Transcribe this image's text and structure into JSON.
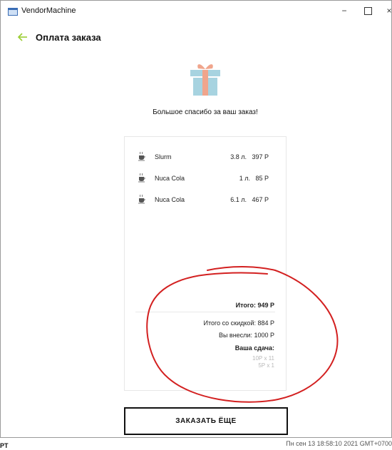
{
  "window": {
    "title": "VendorMachine",
    "minimize": "−",
    "close": "×"
  },
  "header": {
    "title": "Оплата заказа"
  },
  "thanks_text": "Большое спасибо за ваш заказ!",
  "items": [
    {
      "name": "Slurm",
      "volume_price": "3.8 л.   397 Р"
    },
    {
      "name": "Nuca Cola",
      "volume_price": "1 л.   85 Р"
    },
    {
      "name": "Nuca Cola",
      "volume_price": "6.1 л.   467 Р"
    }
  ],
  "summary": {
    "total": "Итого: 949 Р",
    "discount_total": "Итого со скидкой: 884 Р",
    "paid": "Вы внесли: 1000 Р",
    "change_title": "Ваша сдача:",
    "coins": [
      "10Р x 11",
      "5Р x 1"
    ]
  },
  "order_more": "ЗАКАЗАТЬ ЁЩЕ",
  "status": {
    "left": "PT",
    "datetime": "Пн сен 13 18:58:10 2021 GMT+0700"
  },
  "colors": {
    "accent": "#9acd32",
    "gift_box": "#a7d3e0",
    "gift_ribbon": "#f0a58c",
    "annotation": "#d32020"
  },
  "icons": {
    "back": "arrow-left-icon",
    "gift": "gift-icon",
    "item": "coffee-cup-icon"
  }
}
